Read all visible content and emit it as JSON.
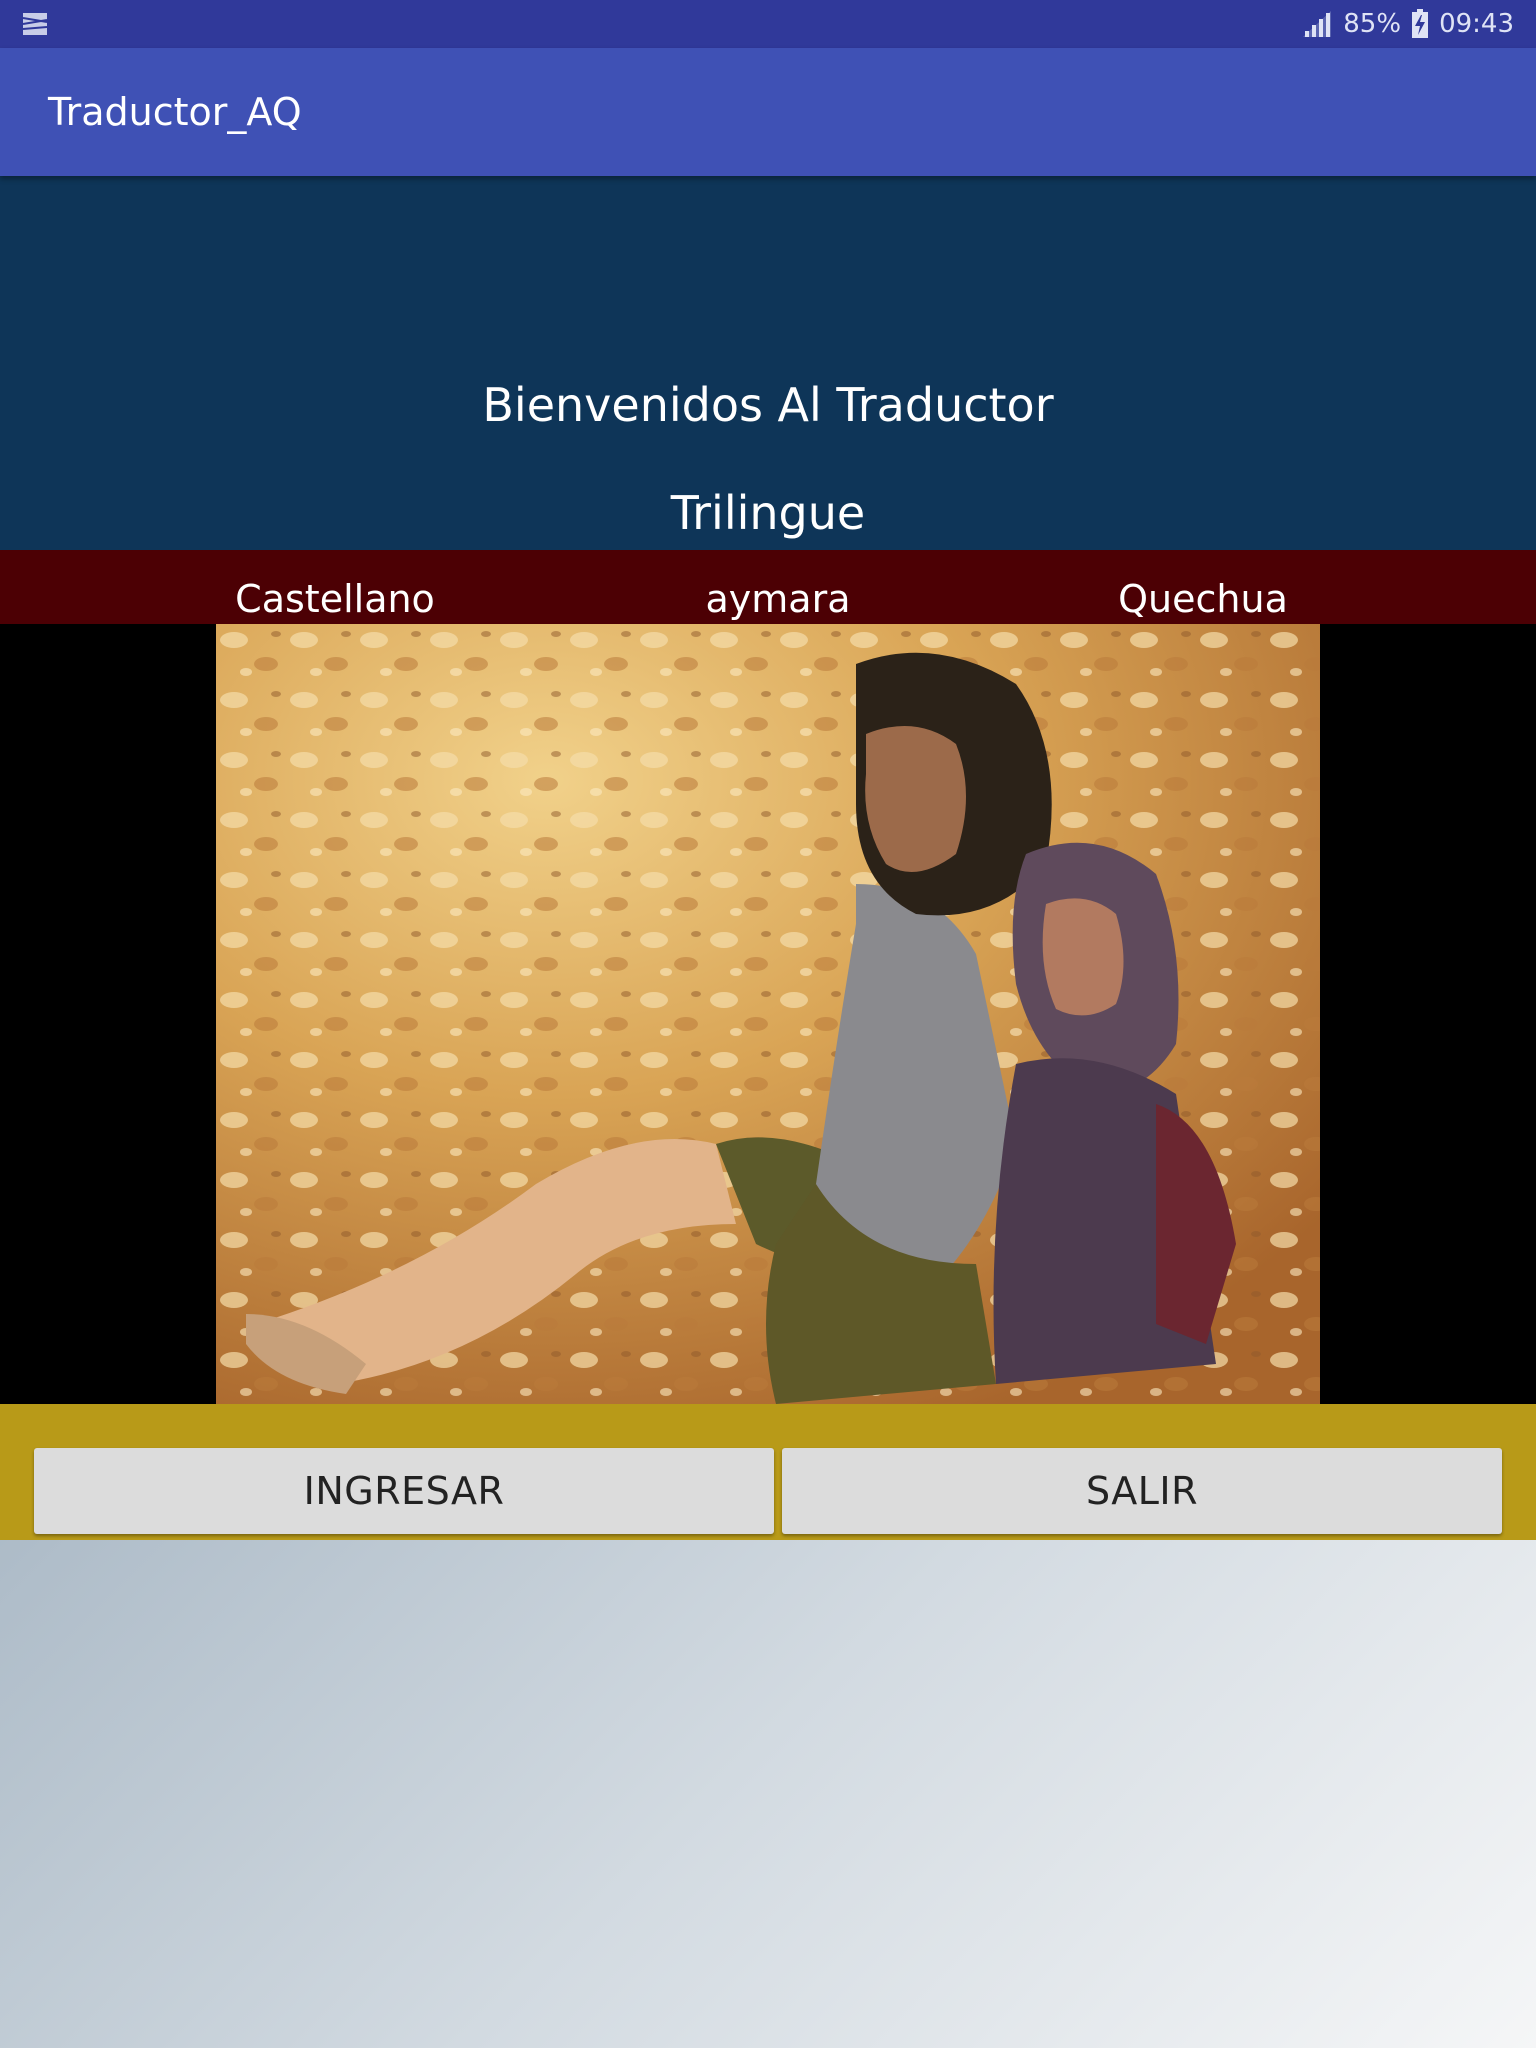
{
  "status_bar": {
    "battery_percent": "85%",
    "time": "09:43",
    "signal_icon": "cellular-signal-icon",
    "battery_icon": "battery-charging-icon",
    "notification_icon": "gallery-notification-icon"
  },
  "app_bar": {
    "title": "Traductor_AQ"
  },
  "welcome": {
    "line1": "Bienvenidos Al Traductor",
    "line2": "Trilingue"
  },
  "languages": [
    "Castellano",
    "aymara",
    "Quechua"
  ],
  "photo": {
    "description_icon": "mother-and-child-photo"
  },
  "buttons": {
    "ingresar": "INGRESAR",
    "salir": "SALIR"
  },
  "colors": {
    "status_bar": "#30399a",
    "app_bar": "#3f51b5",
    "welcome_bg": "#0e3558",
    "lang_strip": "#4c0004",
    "button_bar": "#b89a18",
    "button_bg": "#dcdcdc"
  }
}
